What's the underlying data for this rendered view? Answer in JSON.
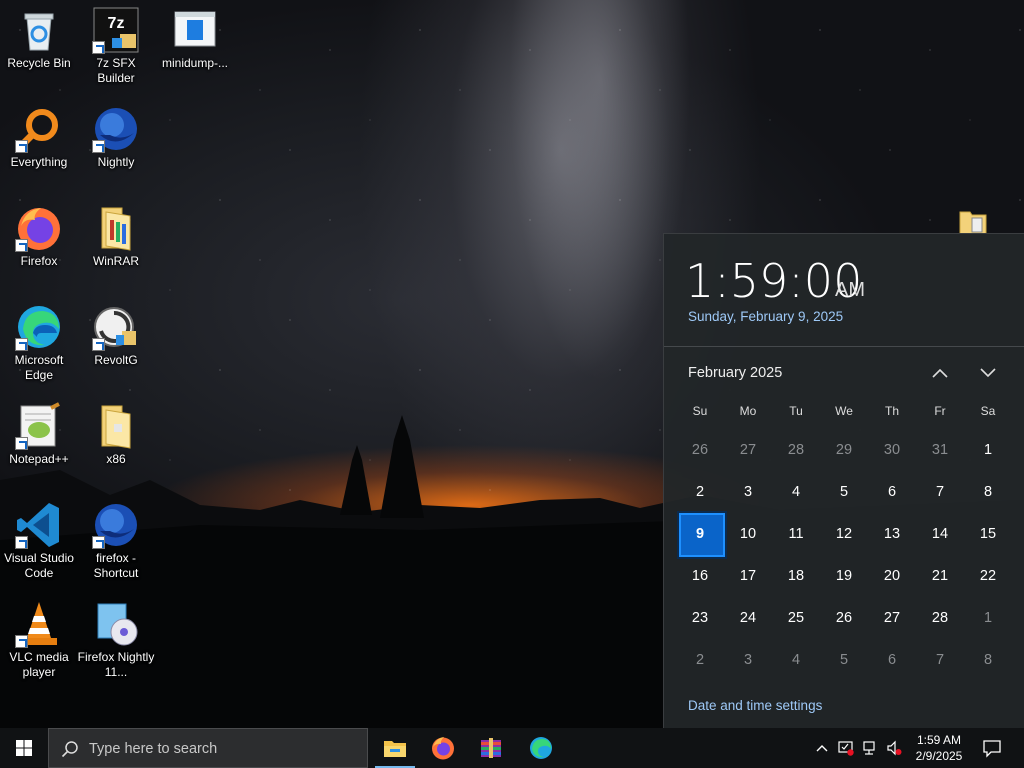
{
  "desktop": {
    "icons": [
      {
        "label": "Recycle Bin"
      },
      {
        "label": "7z SFX Builder"
      },
      {
        "label": "minidump-..."
      },
      {
        "label": "Everything"
      },
      {
        "label": "Nightly"
      },
      {
        "label": "Firefox"
      },
      {
        "label": "WinRAR"
      },
      {
        "label": "Microsoft Edge"
      },
      {
        "label": "RevoltG"
      },
      {
        "label": "Notepad++"
      },
      {
        "label": "x86"
      },
      {
        "label": "Visual Studio Code"
      },
      {
        "label": "firefox - Shortcut"
      },
      {
        "label": "VLC media player"
      },
      {
        "label": "Firefox Nightly 11..."
      }
    ]
  },
  "flyout": {
    "time": "1:59:00",
    "ampm": "AM",
    "long_date": "Sunday, February 9, 2025",
    "month_title": "February 2025",
    "weekdays": [
      "Su",
      "Mo",
      "Tu",
      "We",
      "Th",
      "Fr",
      "Sa"
    ],
    "weeks": [
      [
        "26",
        "27",
        "28",
        "29",
        "30",
        "31",
        "1"
      ],
      [
        "2",
        "3",
        "4",
        "5",
        "6",
        "7",
        "8"
      ],
      [
        "9",
        "10",
        "11",
        "12",
        "13",
        "14",
        "15"
      ],
      [
        "16",
        "17",
        "18",
        "19",
        "20",
        "21",
        "22"
      ],
      [
        "23",
        "24",
        "25",
        "26",
        "27",
        "28",
        "1"
      ],
      [
        "2",
        "3",
        "4",
        "5",
        "6",
        "7",
        "8"
      ]
    ],
    "settings_link": "Date and time settings"
  },
  "taskbar": {
    "search_placeholder": "Type here to search",
    "clock_time": "1:59 AM",
    "clock_date": "2/9/2025",
    "apps": [
      {
        "name": "file-explorer"
      },
      {
        "name": "firefox"
      },
      {
        "name": "winrar"
      },
      {
        "name": "microsoft-edge"
      }
    ]
  },
  "colors": {
    "accent": "#0a64c9",
    "link": "#9ec9f7",
    "taskbar": "#101214",
    "flyout": "#222628"
  }
}
